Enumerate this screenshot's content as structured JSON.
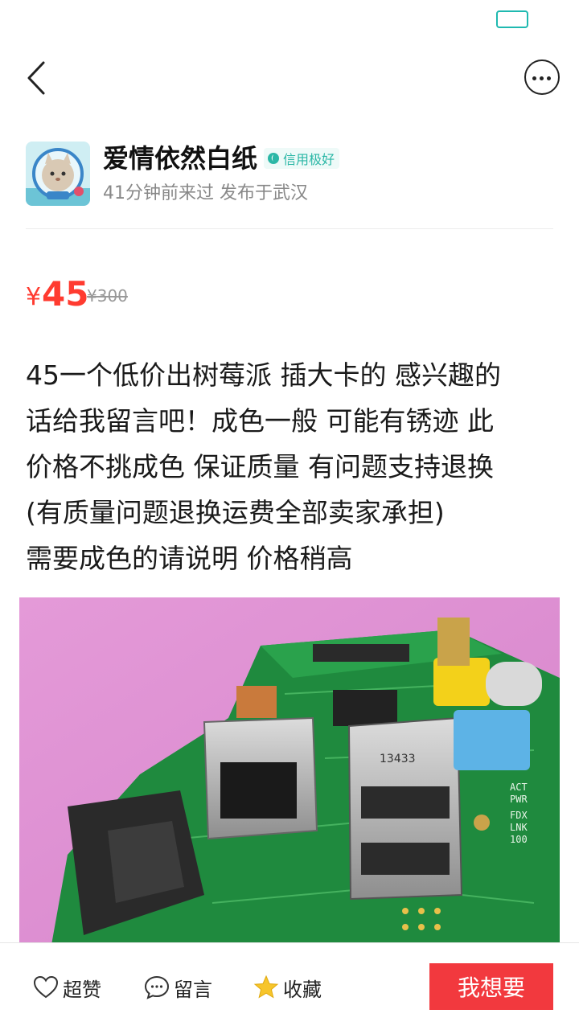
{
  "seller": {
    "name": "爱情依然白纸",
    "credit_badge": "信用极好",
    "meta": "41分钟前来过 发布于武汉"
  },
  "price": {
    "symbol": "¥",
    "current": "45",
    "original": "¥300"
  },
  "description": "45一个低价出树莓派 插大卡的 感兴趣的\n话给我留言吧！成色一般 可能有锈迹 此\n价格不挑成色 保证质量 有问题支持退换\n(有质量问题退换运费全部卖家承担)\n需要成色的请说明 价格稍高",
  "product_image": {
    "board_labels": [
      "13433",
      "ACT",
      "PWR",
      "FDX",
      "LNK",
      "100"
    ]
  },
  "bottom_bar": {
    "like_label": "超赞",
    "comment_label": "留言",
    "favorite_label": "收藏",
    "want_label": "我想要"
  },
  "colors": {
    "accent_red": "#f2393e",
    "price_red": "#ff3b30",
    "credit_teal": "#2bb7a6",
    "battery_teal": "#1fb9b0",
    "star_yellow": "#f7c52b"
  },
  "icons": [
    "battery-icon",
    "back-arrow-icon",
    "more-dots-icon",
    "credit-icon",
    "heart-icon",
    "comment-icon",
    "star-icon"
  ]
}
